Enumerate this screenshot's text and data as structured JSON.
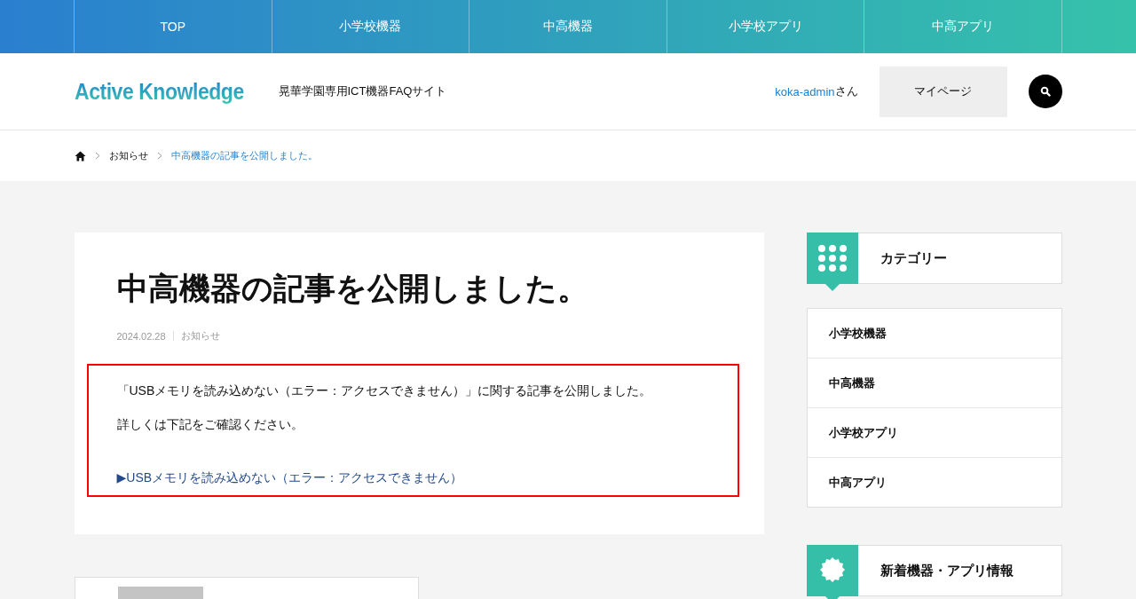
{
  "nav": [
    {
      "label": "TOP"
    },
    {
      "label": "小学校機器"
    },
    {
      "label": "中高機器"
    },
    {
      "label": "小学校アプリ"
    },
    {
      "label": "中高アプリ"
    }
  ],
  "header": {
    "logo": "Active Knowledge",
    "tagline": "晃華学園専用ICT機器FAQサイト",
    "user_name": "koka-admin",
    "user_suffix": "さん",
    "mypage_button": "マイページ"
  },
  "breadcrumb": [
    {
      "label": "お知らせ",
      "current": false
    },
    {
      "label": "中高機器の記事を公開しました。",
      "current": true
    }
  ],
  "article": {
    "title": "中高機器の記事を公開しました。",
    "date": "2024.02.28",
    "category": "お知らせ",
    "paragraphs": [
      "「USBメモリを読み込めない（エラー：アクセスできません）」に関する記事を公開しました。",
      "詳しくは下記をご確認ください。"
    ],
    "link": "▶USBメモリを読み込めない（エラー：アクセスできません）"
  },
  "sidebar": [
    {
      "kind": "grid",
      "heading": "カテゴリー",
      "items": [
        "小学校機器",
        "中高機器",
        "小学校アプリ",
        "中高アプリ"
      ]
    },
    {
      "kind": "new",
      "heading": "新着機器・アプリ情報"
    }
  ]
}
